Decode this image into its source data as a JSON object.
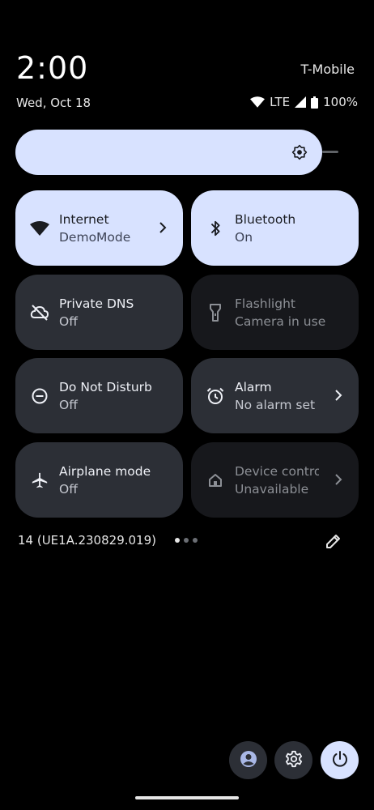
{
  "status_bar": {
    "time": "2:00",
    "carrier": "T-Mobile",
    "date": "Wed, Oct 18",
    "network": "LTE",
    "battery": "100%"
  },
  "brightness": {
    "level": 0.95
  },
  "tiles": [
    {
      "label": "Internet",
      "subtitle": "DemoMode",
      "state": "active",
      "icon": "wifi-icon",
      "has_chevron": true
    },
    {
      "label": "Bluetooth",
      "subtitle": "On",
      "state": "active",
      "icon": "bluetooth-icon",
      "has_chevron": false
    },
    {
      "label": "Private DNS",
      "subtitle": "Off",
      "state": "inactive",
      "icon": "cloud-off-icon",
      "has_chevron": false
    },
    {
      "label": "Flashlight",
      "subtitle": "Camera in use",
      "state": "disabled",
      "icon": "flashlight-icon",
      "has_chevron": false
    },
    {
      "label": "Do Not Disturb",
      "subtitle": "Off",
      "state": "inactive",
      "icon": "do-not-disturb-icon",
      "has_chevron": false
    },
    {
      "label": "Alarm",
      "subtitle": "No alarm set",
      "state": "inactive",
      "icon": "alarm-icon",
      "has_chevron": true
    },
    {
      "label": "Airplane mode",
      "subtitle": "Off",
      "state": "inactive",
      "icon": "airplane-icon",
      "has_chevron": false
    },
    {
      "label": "Device controls",
      "subtitle": "Unavailable",
      "state": "disabled",
      "icon": "home-icon",
      "has_chevron": true
    }
  ],
  "footer": {
    "build_number": "14 (UE1A.230829.019)",
    "page_count": 3,
    "current_page": 1
  },
  "colors": {
    "accent": "#d8e2ff",
    "tile_inactive": "#2c2f36",
    "tile_disabled": "#17181c",
    "background": "#000000"
  }
}
